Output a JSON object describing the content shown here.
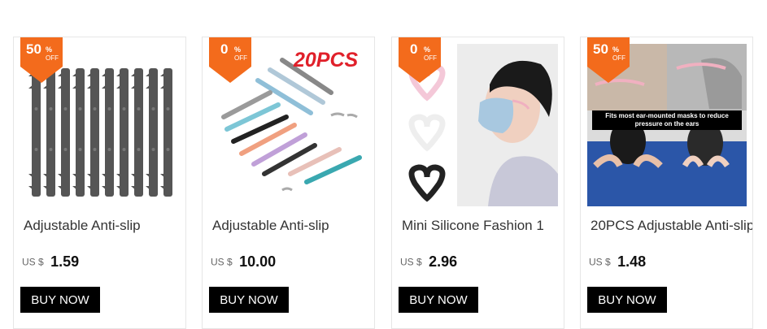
{
  "colors": {
    "badge": "#f36b1c",
    "button_bg": "#000000",
    "button_text": "#ffffff"
  },
  "products": [
    {
      "discount_num": "50",
      "discount_pct": "%",
      "discount_off": "OFF",
      "title": "Adjustable Anti-slip",
      "currency": "US $",
      "price": "1.59",
      "button": "BUY NOW"
    },
    {
      "discount_num": "0",
      "discount_pct": "%",
      "discount_off": "OFF",
      "title": "Adjustable Anti-slip",
      "currency": "US $",
      "price": "10.00",
      "button": "BUY NOW",
      "image_text": "20PCS"
    },
    {
      "discount_num": "0",
      "discount_pct": "%",
      "discount_off": "OFF",
      "title": "Mini Silicone Fashion 1",
      "currency": "US $",
      "price": "2.96",
      "button": "BUY NOW"
    },
    {
      "discount_num": "50",
      "discount_pct": "%",
      "discount_off": "OFF",
      "title": "20PCS Adjustable Anti-slip",
      "currency": "US $",
      "price": "1.48",
      "button": "BUY NOW",
      "image_text": "Fits most ear-mounted masks to reduce pressure on the ears"
    }
  ]
}
